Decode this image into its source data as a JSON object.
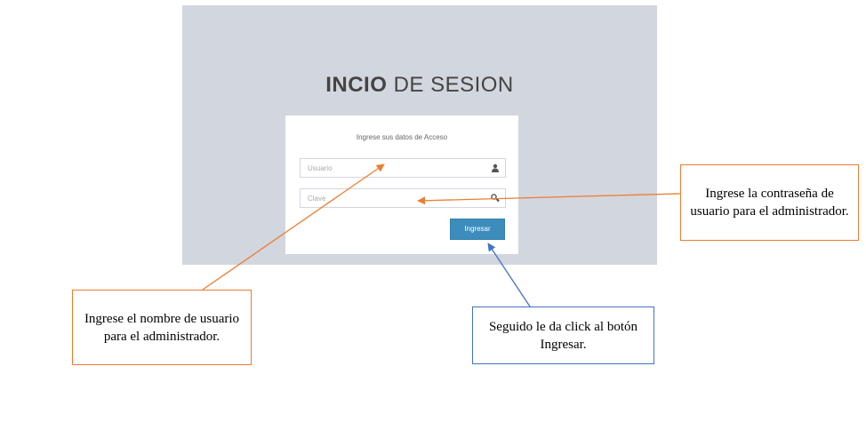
{
  "login": {
    "title_bold": "INCIO",
    "title_light": "DE SESION",
    "message": "Ingrese sus datos de Acceso",
    "username_placeholder": "Usuario",
    "password_placeholder": "Clave",
    "submit_label": "Ingresar",
    "username_icon": "user-icon",
    "password_icon": "key-icon",
    "button_color": "#3c8dbc",
    "background_color": "#d2d6de"
  },
  "callouts": {
    "username": "Ingrese el nombre de usuario para el administrador.",
    "password": "Ingrese la contraseña de usuario para el administrador.",
    "button": "Seguido le da click al botón Ingresar.",
    "orange_color": "#ed7d31",
    "blue_color": "#4472c4"
  }
}
